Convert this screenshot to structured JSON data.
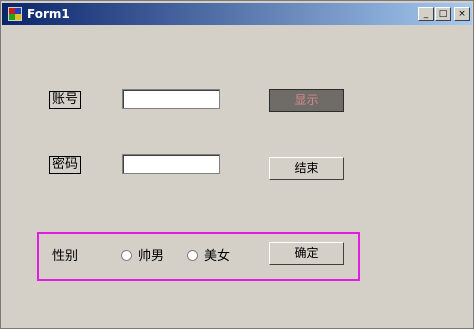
{
  "window": {
    "title": "Form1",
    "min_symbol": "_",
    "max_symbol": "□",
    "close_symbol": "×"
  },
  "form": {
    "account_label": "账号",
    "password_label": "密码",
    "account_value": "",
    "password_value": "",
    "show_button": "显示",
    "end_button": "结束",
    "gender_label": "性别",
    "option_male": "帅男",
    "option_female": "美女",
    "confirm_button": "确定"
  },
  "colors": {
    "form_background": "#d4d0c8",
    "title_bar_start": "#0a246a",
    "title_bar_end": "#a6caf0",
    "highlight_border": "#e01ee0"
  }
}
